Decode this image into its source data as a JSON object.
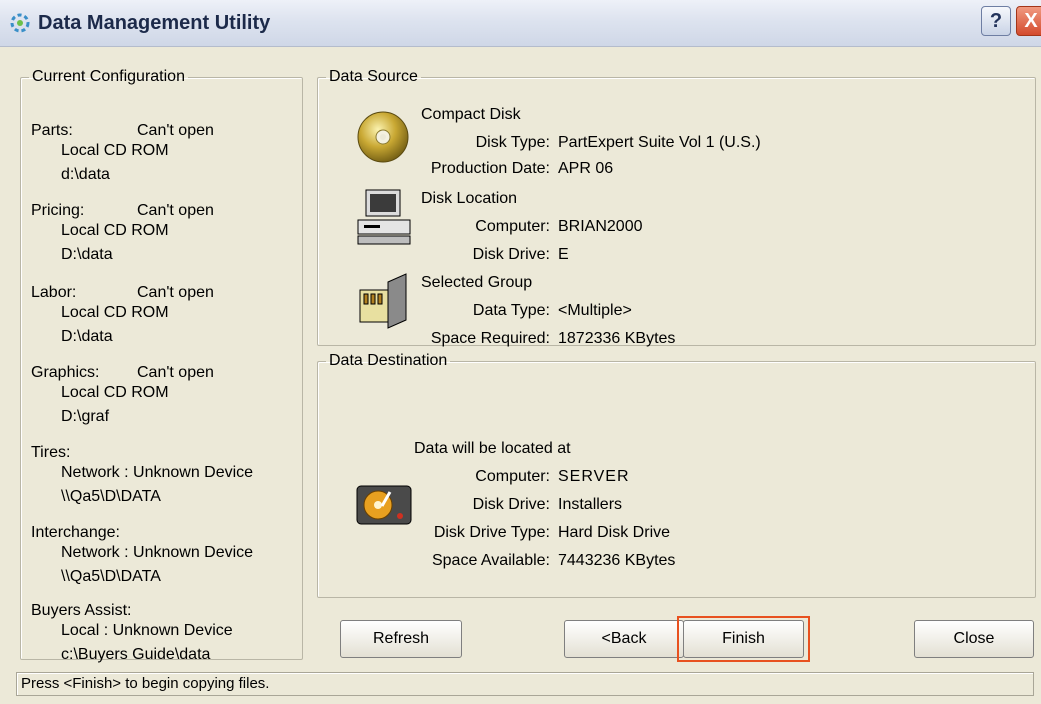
{
  "window": {
    "title": "Data Management Utility",
    "help_label": "?",
    "close_label": "X"
  },
  "config": {
    "legend": "Current Configuration",
    "items": [
      {
        "label": "Parts:",
        "status": "Can't open",
        "location": "Local CD ROM",
        "path": "d:\\data"
      },
      {
        "label": "Pricing:",
        "status": "Can't open",
        "location": "Local CD ROM",
        "path": "D:\\data"
      },
      {
        "label": "Labor:",
        "status": "Can't open",
        "location": "Local CD ROM",
        "path": "D:\\data"
      },
      {
        "label": "Graphics:",
        "status": "Can't open",
        "location": "Local CD ROM",
        "path": "D:\\graf"
      },
      {
        "label": "Tires:",
        "status": "",
        "location": "Network : Unknown Device",
        "path": "\\\\Qa5\\D\\DATA"
      },
      {
        "label": "Interchange:",
        "status": "",
        "location": "Network : Unknown Device",
        "path": "\\\\Qa5\\D\\DATA"
      },
      {
        "label": "Buyers Assist:",
        "status": "",
        "location": "Local : Unknown Device",
        "path": "c:\\Buyers Guide\\data"
      }
    ]
  },
  "source": {
    "legend": "Data Source",
    "compact_disk": {
      "header": "Compact Disk",
      "disk_type_label": "Disk Type:",
      "disk_type": "PartExpert Suite Vol 1 (U.S.)",
      "production_date_label": "Production Date:",
      "production_date": "APR 06"
    },
    "disk_location": {
      "header": "Disk Location",
      "computer_label": "Computer:",
      "computer": "BRIAN2000",
      "disk_drive_label": "Disk Drive:",
      "disk_drive": "E"
    },
    "selected_group": {
      "header": "Selected Group",
      "data_type_label": "Data Type:",
      "data_type": "<Multiple>",
      "space_required_label": "Space Required:",
      "space_required": "1872336 KBytes"
    }
  },
  "destination": {
    "legend": "Data Destination",
    "intro": "Data will be located at",
    "computer_label": "Computer:",
    "computer": "SERVER",
    "disk_drive_label": "Disk Drive:",
    "disk_drive": "Installers",
    "disk_drive_type_label": "Disk Drive Type:",
    "disk_drive_type": "Hard Disk Drive",
    "space_available_label": "Space Available:",
    "space_available": "7443236 KBytes"
  },
  "buttons": {
    "refresh": "Refresh",
    "back": "<Back",
    "finish": "Finish",
    "close": "Close"
  },
  "status_bar": "Press <Finish> to begin copying files.",
  "colors": {
    "highlight": "#e8511f",
    "face": "#ece9d8"
  },
  "icons": [
    "app-icon",
    "cd-icon",
    "computer-icon",
    "group-icon",
    "hard-disk-icon"
  ]
}
